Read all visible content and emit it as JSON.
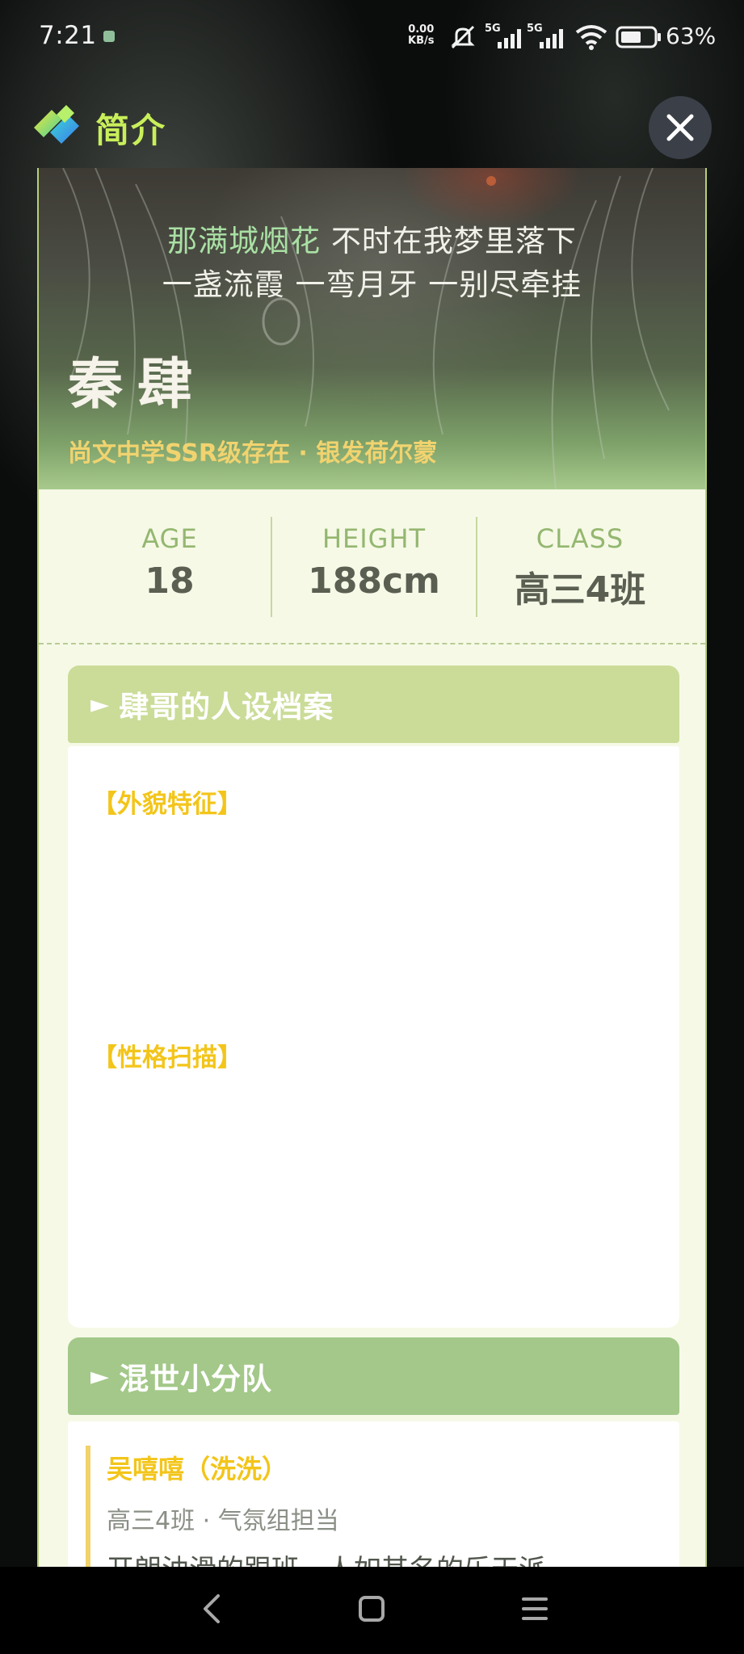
{
  "status_bar": {
    "time": "7:21",
    "net_speed_value": "0.00",
    "net_speed_unit": "KB/s",
    "signal_1": "5G",
    "signal_2": "5G",
    "battery": "63%"
  },
  "header": {
    "title": "简介",
    "logo_icon": "app-logo-icon",
    "close_icon": "close-icon"
  },
  "hero": {
    "lyric_accent": "那满城烟花",
    "lyric_line1_rest": " 不时在我梦里落下",
    "lyric_line2": "一盏流霞 一弯月牙 一别尽牵挂",
    "name": "秦肆",
    "tagline": "尚文中学SSR级存在 · 银发荷尔蒙"
  },
  "stats": [
    {
      "label": "AGE",
      "value": "18"
    },
    {
      "label": "HEIGHT",
      "value": "188cm"
    },
    {
      "label": "CLASS",
      "value": "高三4班"
    }
  ],
  "profile_section": {
    "arrow": "►",
    "title": "肆哥的人设档案",
    "appearance_heading": "【外貌特征】",
    "personality_heading": "【性格扫描】"
  },
  "squad_section": {
    "arrow": "►",
    "title": "混世小分队",
    "members": [
      {
        "name": "吴嘻嘻（洗洗）",
        "role": "高三4班 · 气氛组担当",
        "desc": "开朗油滑的跟班，人如其名的乐天派。"
      }
    ]
  },
  "colors": {
    "title_accent": "#c8ef5a",
    "sheet_bg": "#f6f9e6",
    "section1_head": "#cadc98",
    "section2_head": "#a3c889",
    "heading_yellow": "#f3c51a",
    "tagline": "#f1d36f"
  },
  "nav_bar": {
    "back_icon": "back-chevron-icon",
    "home_icon": "home-square-icon",
    "menu_icon": "menu-lines-icon"
  }
}
